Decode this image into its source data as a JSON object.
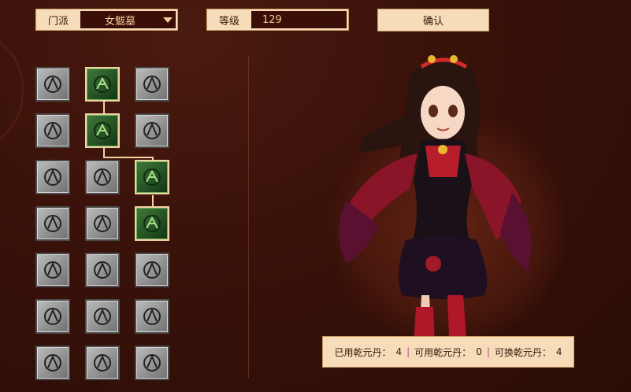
{
  "header": {
    "sect_label": "门派",
    "sect_value": "女魃墓",
    "level_label": "等级",
    "level_value": "129",
    "confirm_label": "确认"
  },
  "skills": [
    {
      "id": "r1c1",
      "icon": "claw-skill-icon",
      "active": false
    },
    {
      "id": "r1c2",
      "icon": "demon-skill-icon",
      "active": true
    },
    {
      "id": "r1c3",
      "icon": "swirl-skill-icon",
      "active": false
    },
    {
      "id": "r2c1",
      "icon": "beast-skill-icon",
      "active": false
    },
    {
      "id": "r2c2",
      "icon": "hand-skill-icon",
      "active": true
    },
    {
      "id": "r2c3",
      "icon": "sword-skill-icon",
      "active": false
    },
    {
      "id": "r3c1",
      "icon": "eye-skill-icon",
      "active": false
    },
    {
      "id": "r3c2",
      "icon": "fire-skill-icon",
      "active": false
    },
    {
      "id": "r3c3",
      "icon": "skull-skill-icon",
      "active": true
    },
    {
      "id": "r4c1",
      "icon": "serpent-skill-icon",
      "active": false
    },
    {
      "id": "r4c2",
      "icon": "cage-skill-icon",
      "active": false
    },
    {
      "id": "r4c3",
      "icon": "flame-skill-icon",
      "active": true
    },
    {
      "id": "r5c1",
      "icon": "slash-skill-icon",
      "active": false
    },
    {
      "id": "r5c2",
      "icon": "splash-skill-icon",
      "active": false
    },
    {
      "id": "r5c3",
      "icon": "blaze-skill-icon",
      "active": false
    },
    {
      "id": "r6c1",
      "icon": "vortex-skill-icon",
      "active": false
    },
    {
      "id": "r6c2",
      "icon": "shatter-skill-icon",
      "active": false
    },
    {
      "id": "r6c3",
      "icon": "ghost-skill-icon",
      "active": false
    },
    {
      "id": "r7c1",
      "icon": "snake-skill-icon",
      "active": false
    },
    {
      "id": "r7c2",
      "icon": "dragon-skill-icon",
      "active": false
    },
    {
      "id": "r7c3",
      "icon": "spikes-skill-icon",
      "active": false
    }
  ],
  "footer": {
    "used_label": "已用乾元丹：",
    "used_value": "4",
    "available_label": "可用乾元丹：",
    "available_value": "0",
    "exchangeable_label": "可换乾元丹：",
    "exchangeable_value": "4"
  }
}
